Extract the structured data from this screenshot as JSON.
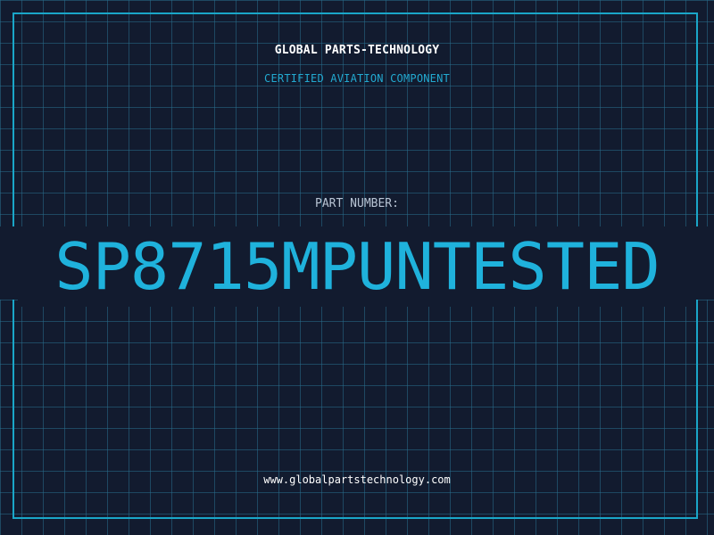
{
  "header": {
    "company": "GLOBAL PARTS-TECHNOLOGY",
    "subtitle": "CERTIFIED AVIATION COMPONENT"
  },
  "part": {
    "label": "PART NUMBER:",
    "number": "SP8715MPUNTESTED"
  },
  "footer": {
    "website": "www.globalpartstechnology.com"
  },
  "colors": {
    "background": "#121b2f",
    "grid": "#286e8c",
    "accent": "#1fb2dc",
    "text": "#ffffff"
  }
}
